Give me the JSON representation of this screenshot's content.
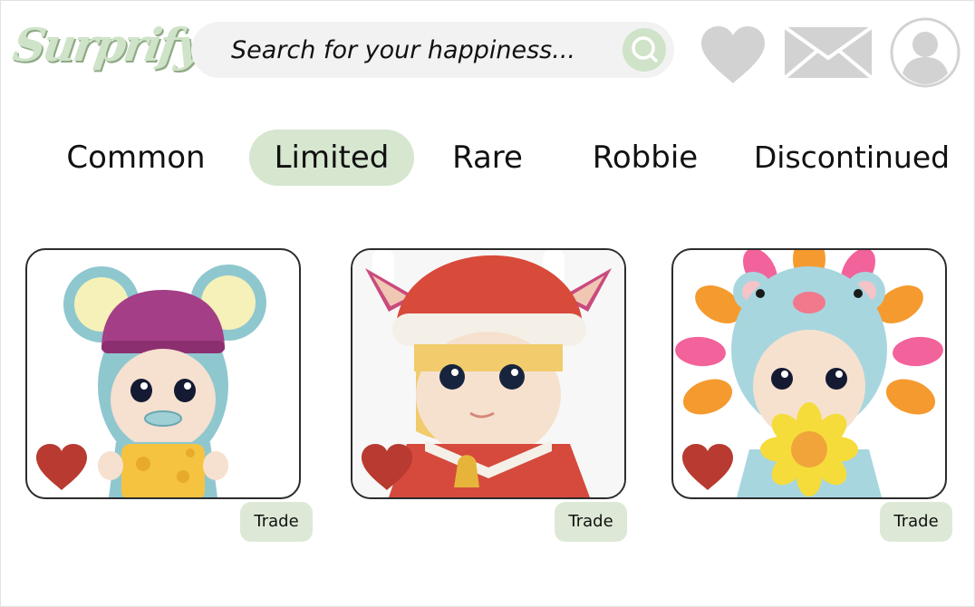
{
  "brand": {
    "logo_text": "Surprify"
  },
  "search": {
    "placeholder": "Search for your happiness..."
  },
  "header": {
    "icons": [
      "heart-icon",
      "mail-icon",
      "user-avatar-icon",
      "search-icon"
    ]
  },
  "tabs": [
    {
      "label": "Common",
      "active": false
    },
    {
      "label": "Limited",
      "active": true
    },
    {
      "label": "Rare",
      "active": false
    },
    {
      "label": "Robbie",
      "active": false
    },
    {
      "label": "Discontinued",
      "active": false
    }
  ],
  "products": [
    {
      "figure": "mouse-figure",
      "trade_label": "Trade",
      "favorited": true
    },
    {
      "figure": "reindeer-santa-figure",
      "trade_label": "Trade",
      "favorited": true
    },
    {
      "figure": "sunflower-bear-figure",
      "trade_label": "Trade",
      "favorited": true
    }
  ],
  "colors": {
    "accent": "#d6e6cf",
    "heart_red": "#b83a30",
    "icon_gray": "#d2d2d2",
    "logo_green": "#cfe3c8"
  }
}
